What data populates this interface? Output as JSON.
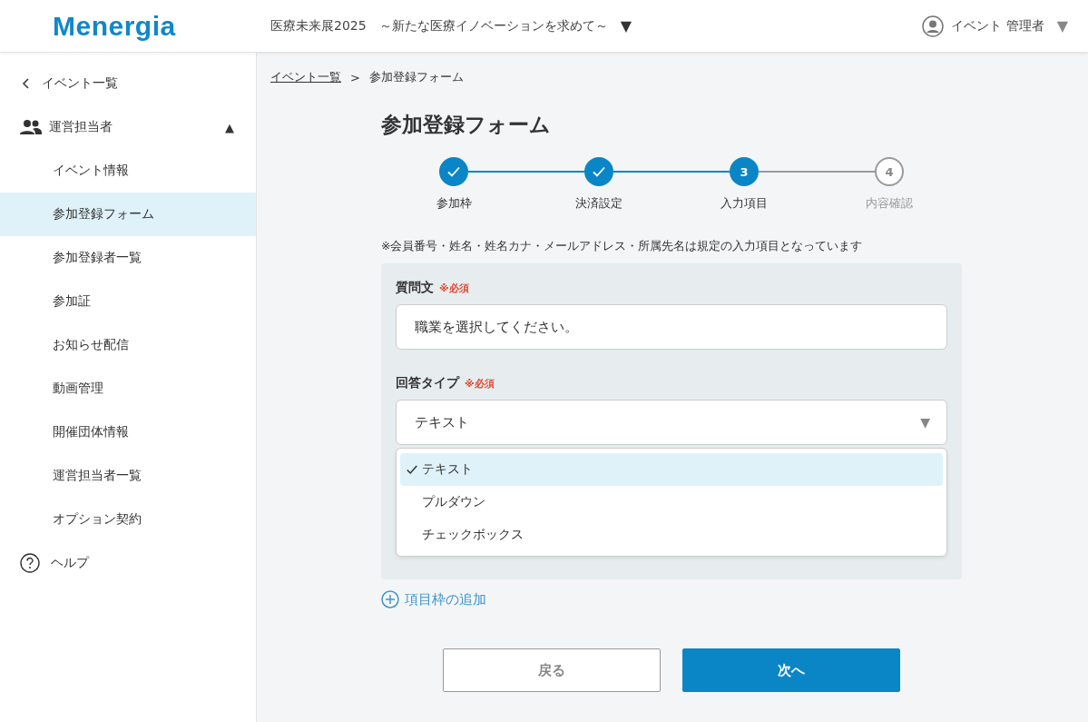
{
  "header": {
    "logo": "Menergia",
    "event_title": "医療未来展2025　～新たな医療イノベーションを求めて～",
    "event_caret": "▼",
    "user": "イベント 管理者",
    "user_caret": "▼"
  },
  "sidebar": {
    "back": "イベント一覧",
    "section": {
      "label": "運営担当者",
      "caret": "▲",
      "expanded": true
    },
    "items": [
      {
        "label": "イベント情報",
        "selected": false
      },
      {
        "label": "参加登録フォーム",
        "selected": true
      },
      {
        "label": "参加登録者一覧",
        "selected": false
      },
      {
        "label": "参加証",
        "selected": false
      },
      {
        "label": "お知らせ配信",
        "selected": false
      },
      {
        "label": "動画管理",
        "selected": false
      },
      {
        "label": "開催団体情報",
        "selected": false
      },
      {
        "label": "運営担当者一覧",
        "selected": false
      },
      {
        "label": "オプション契約",
        "selected": false
      }
    ],
    "help": "ヘルプ"
  },
  "breadcrumb": {
    "link": "イベント一覧",
    "separator": ">",
    "current": "参加登録フォーム"
  },
  "page_title": "参加登録フォーム",
  "steps": [
    {
      "label": "参加枠",
      "kind": "done"
    },
    {
      "label": "決済設定",
      "kind": "done"
    },
    {
      "label": "入力項目",
      "kind": "current",
      "number": "3"
    },
    {
      "label": "内容確認",
      "kind": "todo",
      "number": "4"
    }
  ],
  "note": "※会員番号・姓名・姓名カナ・メールアドレス・所属先名は規定の入力項目となっています",
  "question": {
    "label": "質問文",
    "required": "※必須",
    "value": "職業を選択してください。"
  },
  "answer_type": {
    "label": "回答タイプ",
    "required": "※必須",
    "value": "テキスト",
    "caret": "▼",
    "expanded": true,
    "options": [
      {
        "label": "テキスト",
        "selected": true
      },
      {
        "label": "プルダウン",
        "selected": false
      },
      {
        "label": "チェックボックス",
        "selected": false
      }
    ]
  },
  "add_link": "項目枠の追加",
  "buttons": {
    "back": "戻る",
    "next": "次へ"
  }
}
